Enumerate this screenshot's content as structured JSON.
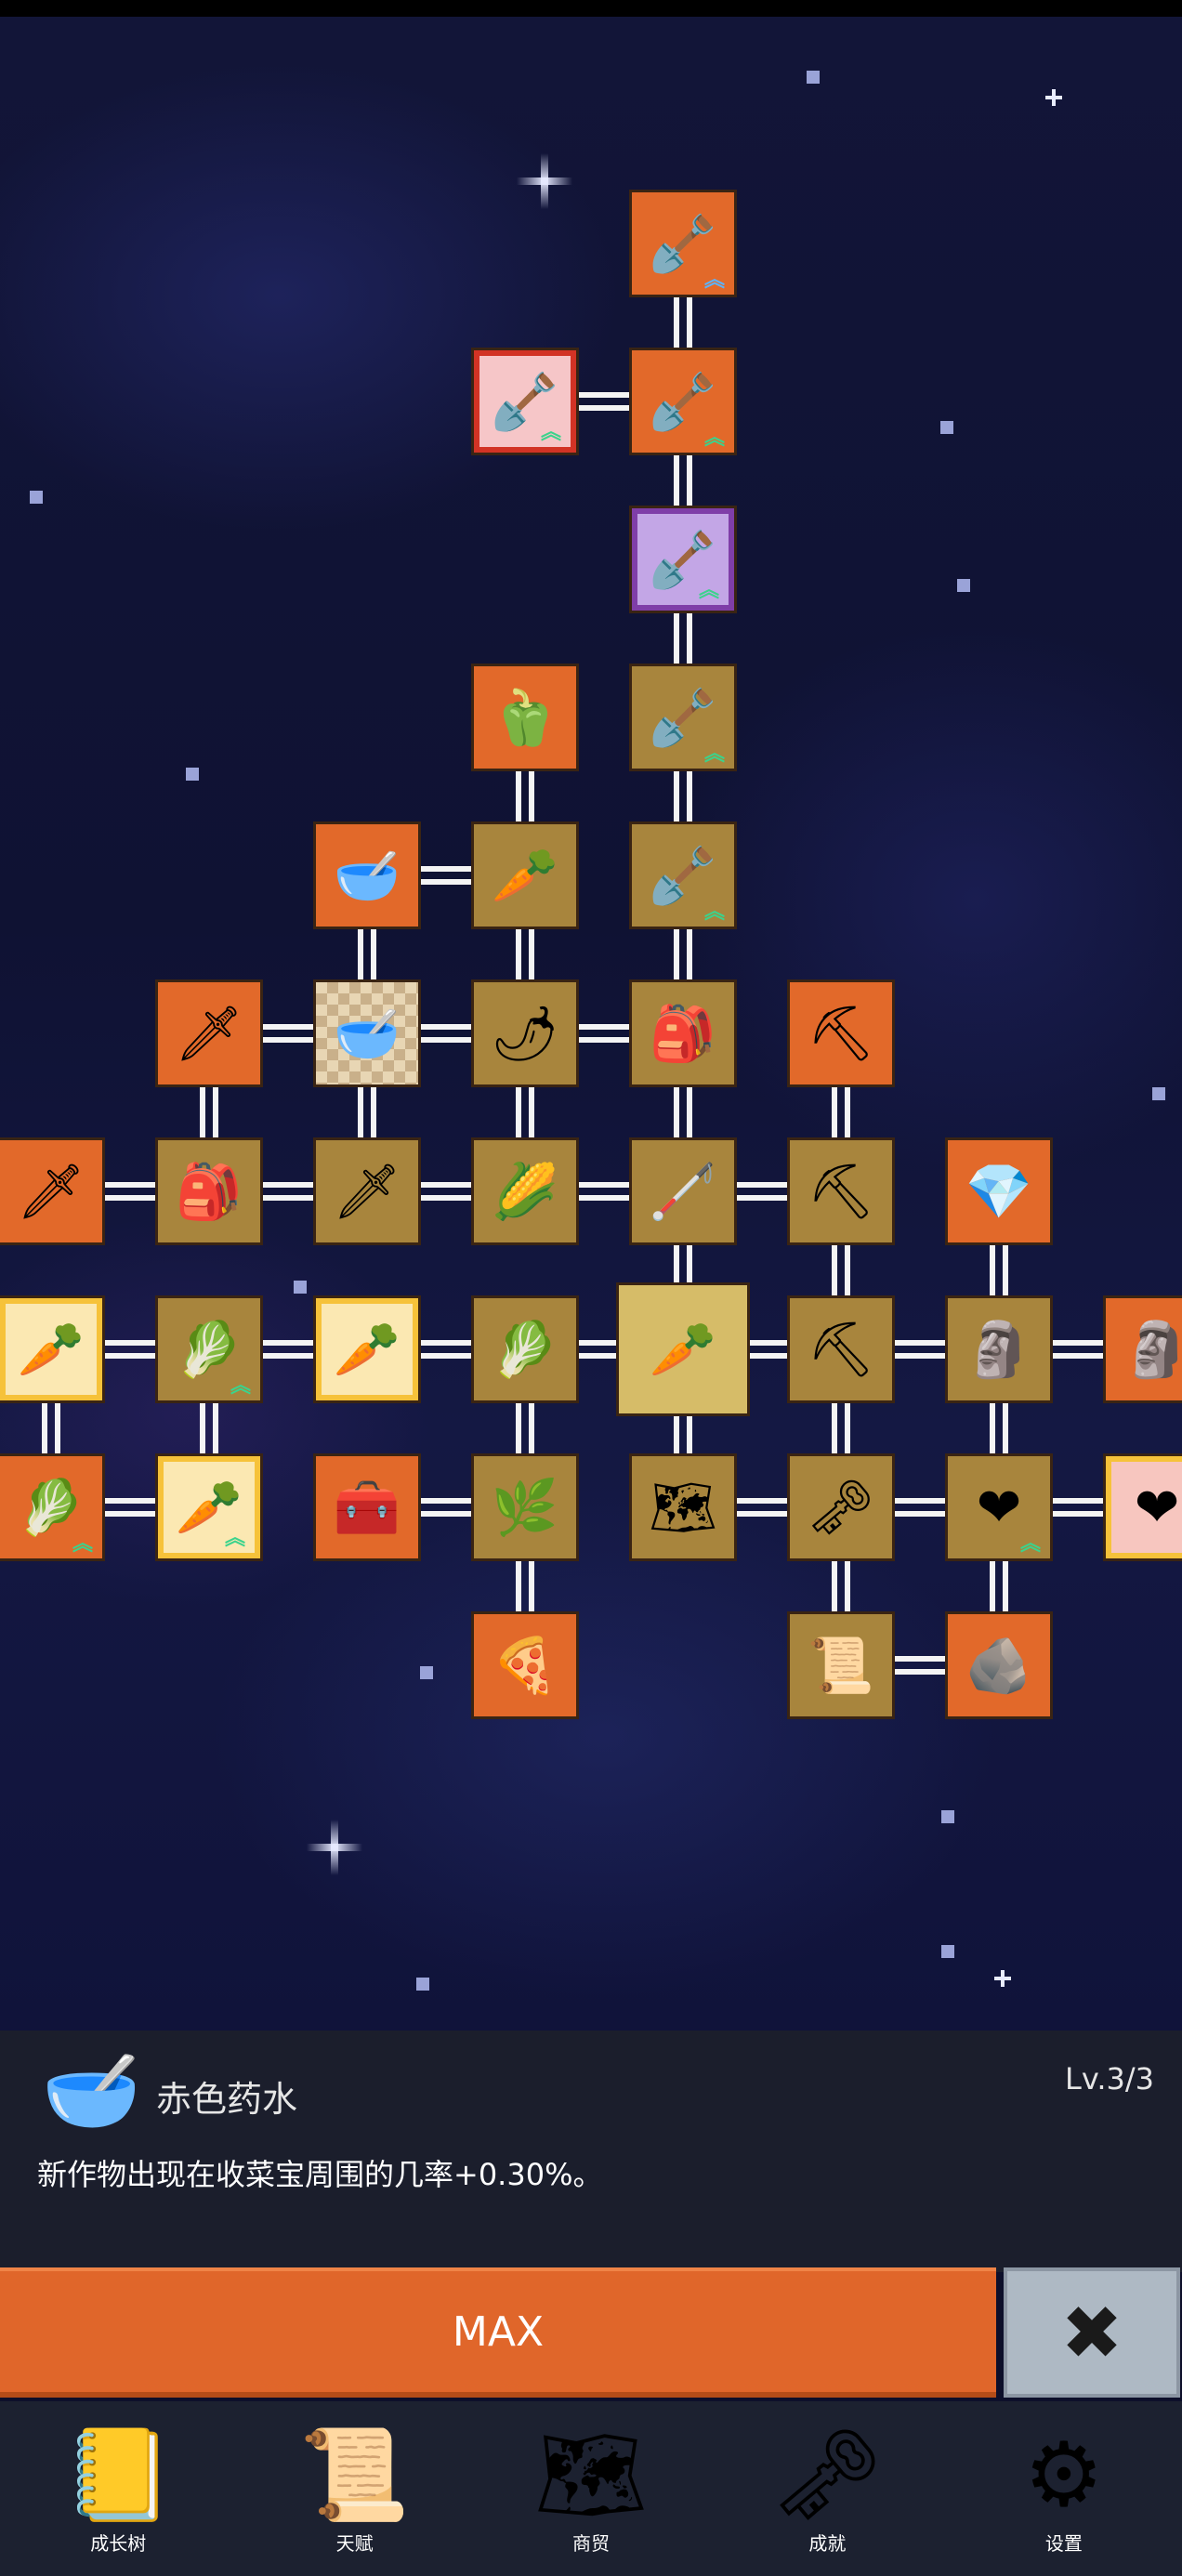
{
  "tree_nodes": [
    {
      "key": "shovel-top",
      "icon": "🪏",
      "bg": "orange",
      "chev": "blue",
      "name": "shovel-node"
    },
    {
      "key": "shovel-pink",
      "icon": "🪏",
      "bg": "pinkbg",
      "frame": "red",
      "chev": "green",
      "name": "shovel-node"
    },
    {
      "key": "shovel-2",
      "icon": "🪏",
      "bg": "orange",
      "chev": "green",
      "name": "shovel-node"
    },
    {
      "key": "shovel-purple",
      "icon": "🪏",
      "bg": "purplebg",
      "frame": "purple",
      "chev": "green",
      "name": "shovel-node"
    },
    {
      "key": "pepper",
      "icon": "🫑",
      "bg": "orange",
      "name": "green-pepper-node"
    },
    {
      "key": "shovel-4",
      "icon": "🪏",
      "bg": "gold",
      "chev": "green",
      "name": "shovel-node"
    },
    {
      "key": "bowl-1",
      "icon": "🥣",
      "bg": "orange",
      "name": "bowl-node"
    },
    {
      "key": "radish",
      "icon": "🥕",
      "bg": "gold",
      "name": "radish-node"
    },
    {
      "key": "shovel-5",
      "icon": "🪏",
      "bg": "gold",
      "chev": "green",
      "name": "shovel-node"
    },
    {
      "key": "sword-gold",
      "icon": "🗡",
      "bg": "orange",
      "name": "golden-sword-node"
    },
    {
      "key": "bowl-red-potion",
      "icon": "🥣",
      "bg": "check",
      "name": "red-potion-node"
    },
    {
      "key": "chili",
      "icon": "🌶",
      "bg": "gold",
      "name": "chili-node"
    },
    {
      "key": "backpack-1",
      "icon": "🎒",
      "bg": "gold",
      "name": "backpack-node"
    },
    {
      "key": "pickaxe-1",
      "icon": "⛏",
      "bg": "orange",
      "name": "pickaxe-node"
    },
    {
      "key": "sword-1",
      "icon": "🗡",
      "bg": "orange",
      "name": "sword-node"
    },
    {
      "key": "backpack-2",
      "icon": "🎒",
      "bg": "gold",
      "name": "backpack-node"
    },
    {
      "key": "sword-2",
      "icon": "🗡",
      "bg": "gold",
      "name": "sword-node"
    },
    {
      "key": "corn",
      "icon": "🌽",
      "bg": "gold",
      "name": "corn-node"
    },
    {
      "key": "stick",
      "icon": "🦯",
      "bg": "gold",
      "name": "stick-node"
    },
    {
      "key": "pickaxe-2",
      "icon": "⛏",
      "bg": "gold",
      "name": "pickaxe-node"
    },
    {
      "key": "crystal",
      "icon": "💎",
      "bg": "orange",
      "name": "crystal-node"
    },
    {
      "key": "carrot-1",
      "icon": "🥕",
      "bg": "orange",
      "frame": "gold",
      "name": "carrot-node"
    },
    {
      "key": "cabbage-1",
      "icon": "🥬",
      "bg": "gold",
      "chev": "green",
      "name": "cabbage-node"
    },
    {
      "key": "carrot-2",
      "icon": "🥕",
      "bg": "orange",
      "frame": "gold",
      "name": "carrot-node"
    },
    {
      "key": "cabbage-2",
      "icon": "🥬",
      "bg": "gold",
      "name": "cabbage-node"
    },
    {
      "key": "carrot-center",
      "icon": "🥕",
      "bg": "sel",
      "name": "carrot-node-selected"
    },
    {
      "key": "pickaxe-3",
      "icon": "⛏",
      "bg": "gold",
      "name": "pickaxe-node"
    },
    {
      "key": "statue-1",
      "icon": "🗿",
      "bg": "gold",
      "name": "statue-node"
    },
    {
      "key": "statue-2",
      "icon": "🗿",
      "bg": "orange",
      "name": "statue-node"
    },
    {
      "key": "cabbage-3",
      "icon": "🥬",
      "bg": "orange",
      "chev": "green",
      "name": "cabbage-node"
    },
    {
      "key": "carrot-3",
      "icon": "🥕",
      "bg": "gold",
      "frame": "gold",
      "chev": "green",
      "name": "carrot-node"
    },
    {
      "key": "chest",
      "icon": "🧰",
      "bg": "orange",
      "name": "treasure-chest-node"
    },
    {
      "key": "leek",
      "icon": "🌿",
      "bg": "gold",
      "name": "leek-node"
    },
    {
      "key": "map",
      "icon": "🗺",
      "bg": "gold",
      "name": "map-node"
    },
    {
      "key": "key",
      "icon": "🗝",
      "bg": "gold",
      "name": "key-node"
    },
    {
      "key": "heart-1",
      "icon": "❤",
      "bg": "gold",
      "chev": "green",
      "name": "heart-node"
    },
    {
      "key": "heart-2",
      "icon": "❤",
      "bg": "orange",
      "frame": "gold2",
      "name": "heart-node"
    },
    {
      "key": "pizza",
      "icon": "🍕",
      "bg": "orange",
      "name": "pizza-node"
    },
    {
      "key": "scroll",
      "icon": "📜",
      "bg": "gold",
      "name": "scroll-node"
    },
    {
      "key": "fossil",
      "icon": "🪨",
      "bg": "orange",
      "name": "fossil-node"
    }
  ],
  "detail": {
    "icon": "🥣",
    "name": "赤色药水",
    "level": "Lv.3/3",
    "description": "新作物出现在收菜宝周围的几率+0.30%。"
  },
  "actions": {
    "max_label": "MAX",
    "close_icon": "✖"
  },
  "nav": [
    {
      "icon": "📒",
      "label": "成长树",
      "name": "growth-tree"
    },
    {
      "icon": "📜",
      "label": "天赋",
      "name": "talent"
    },
    {
      "icon": "🗺",
      "label": "商贸",
      "name": "trade"
    },
    {
      "icon": "🗝",
      "label": "成就",
      "name": "achievement"
    },
    {
      "icon": "⚙",
      "label": "设置",
      "name": "settings"
    }
  ]
}
